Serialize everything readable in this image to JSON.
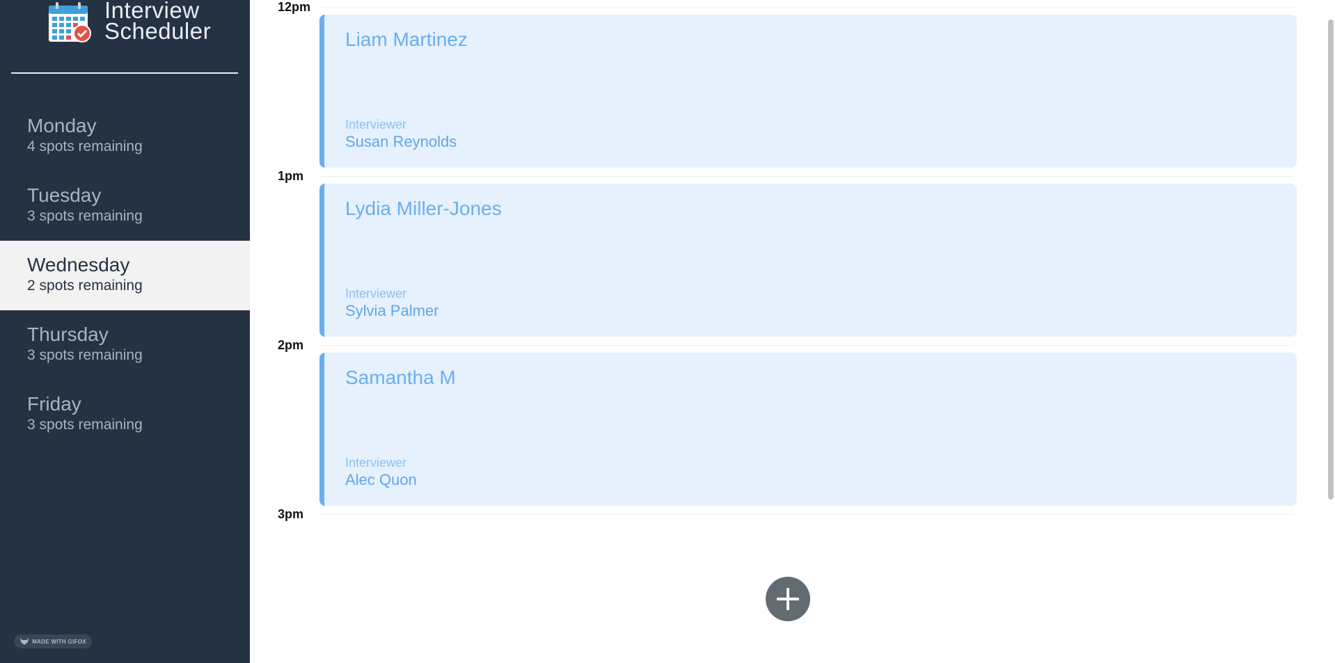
{
  "app": {
    "title_line1": "Interview",
    "title_line2": "Scheduler",
    "logo_icon": "calendar-check-icon"
  },
  "sidebar": {
    "days": [
      {
        "name": "Monday",
        "spots": "4 spots remaining",
        "selected": false
      },
      {
        "name": "Tuesday",
        "spots": "3 spots remaining",
        "selected": false
      },
      {
        "name": "Wednesday",
        "spots": "2 spots remaining",
        "selected": true
      },
      {
        "name": "Thursday",
        "spots": "3 spots remaining",
        "selected": false
      },
      {
        "name": "Friday",
        "spots": "3 spots remaining",
        "selected": false
      }
    ],
    "badge": "MADE WITH GIFOX"
  },
  "schedule": {
    "times": [
      "12pm",
      "1pm",
      "2pm",
      "3pm"
    ],
    "appointments": [
      {
        "student": "Liam Martinez",
        "interviewer_label": "Interviewer",
        "interviewer": "Susan Reynolds"
      },
      {
        "student": "Lydia Miller-Jones",
        "interviewer_label": "Interviewer",
        "interviewer": "Sylvia Palmer"
      },
      {
        "student": "Samantha M",
        "interviewer_label": "Interviewer",
        "interviewer": "Alec Quon"
      }
    ],
    "add_icon": "plus-icon"
  },
  "colors": {
    "sidebar_bg": "#253243",
    "selected_bg": "#f2f2f2",
    "card_bg": "#e6f1fd",
    "accent_blue": "#6aaef0",
    "add_button": "#626a72"
  }
}
